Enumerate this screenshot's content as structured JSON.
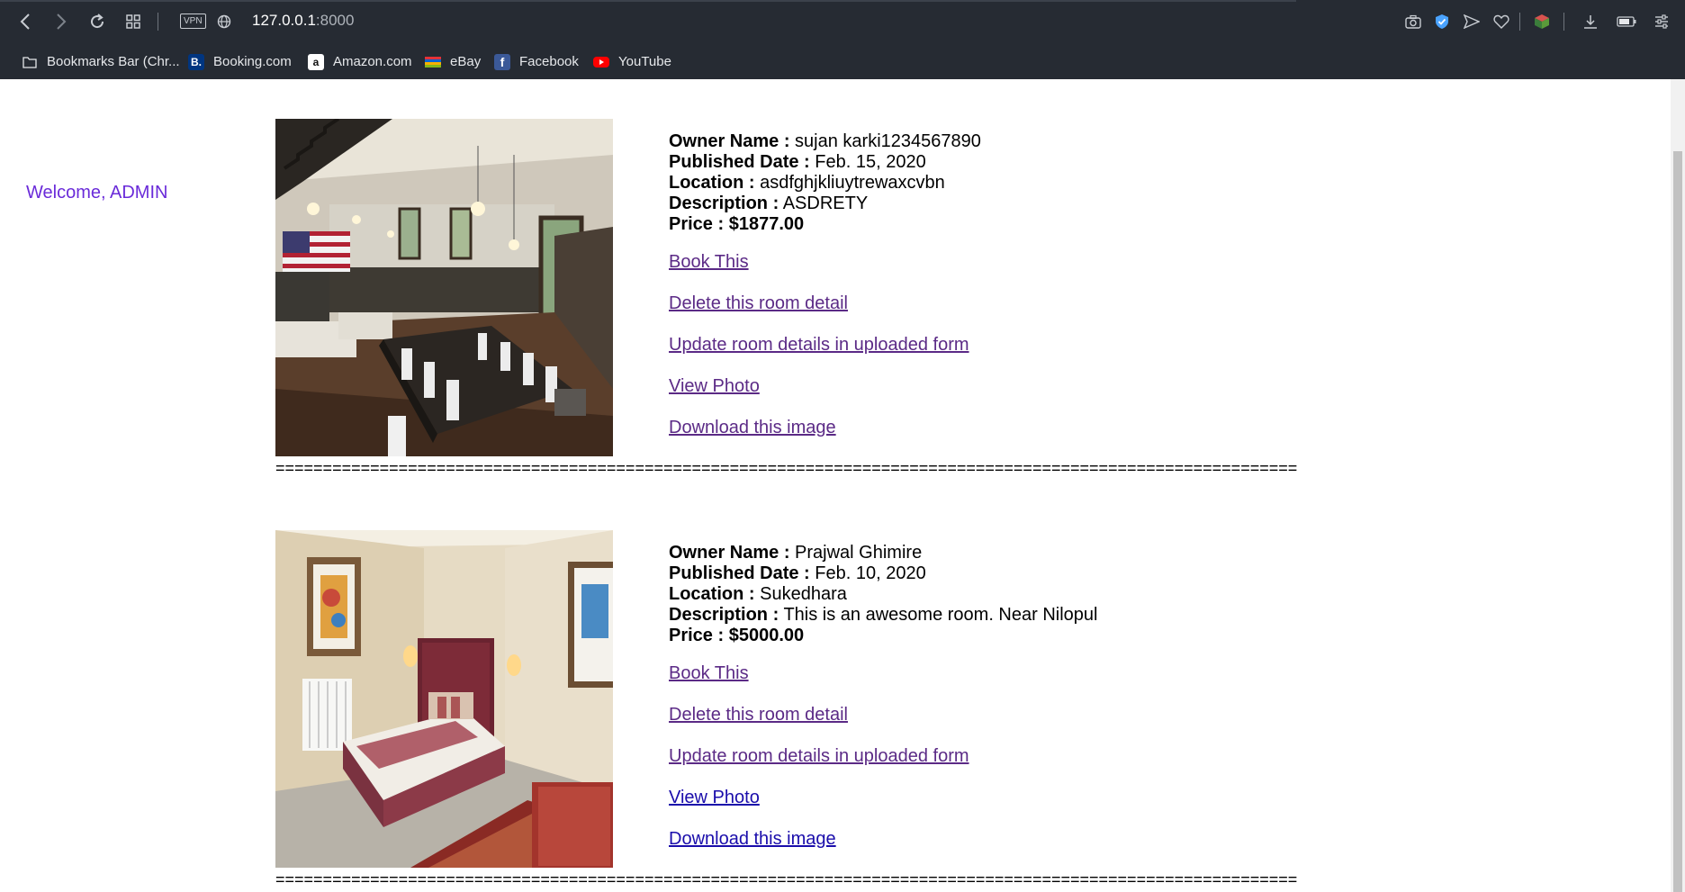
{
  "browser": {
    "url_host": "127.0.0.1",
    "url_port": ":8000",
    "vpn_label": "VPN",
    "bookmarks": [
      {
        "label": "Bookmarks Bar (Chr...",
        "icon": "folder-icon"
      },
      {
        "label": "Booking.com",
        "icon": "booking-icon"
      },
      {
        "label": "Amazon.com",
        "icon": "amazon-icon"
      },
      {
        "label": "eBay",
        "icon": "ebay-icon"
      },
      {
        "label": "Facebook",
        "icon": "facebook-icon"
      },
      {
        "label": "YouTube",
        "icon": "youtube-icon"
      }
    ]
  },
  "page": {
    "welcome": "Welcome, ADMIN",
    "labels": {
      "owner": "Owner Name :",
      "published": "Published Date :",
      "location": "Location :",
      "description": "Description :",
      "price": "Price :"
    },
    "divider": "============================================================================================================",
    "listings": [
      {
        "owner": "sujan karki1234567890",
        "published": "Feb. 15, 2020",
        "location": "asdfghjkliuytrewaxcvbn",
        "description": "ASDRETY",
        "price": "$1877.00",
        "links": {
          "book": "Book This",
          "delete": "Delete this room detail",
          "update": "Update room details in uploaded form",
          "view": "View Photo",
          "download": "Download this image"
        }
      },
      {
        "owner": "Prajwal Ghimire",
        "published": "Feb. 10, 2020",
        "location": "Sukedhara",
        "description": "This is an awesome room. Near Nilopul",
        "price": "$5000.00",
        "links": {
          "book": "Book This",
          "delete": "Delete this room detail",
          "update": "Update room details in uploaded form",
          "view": "View Photo",
          "download": "Download this image"
        }
      }
    ]
  }
}
